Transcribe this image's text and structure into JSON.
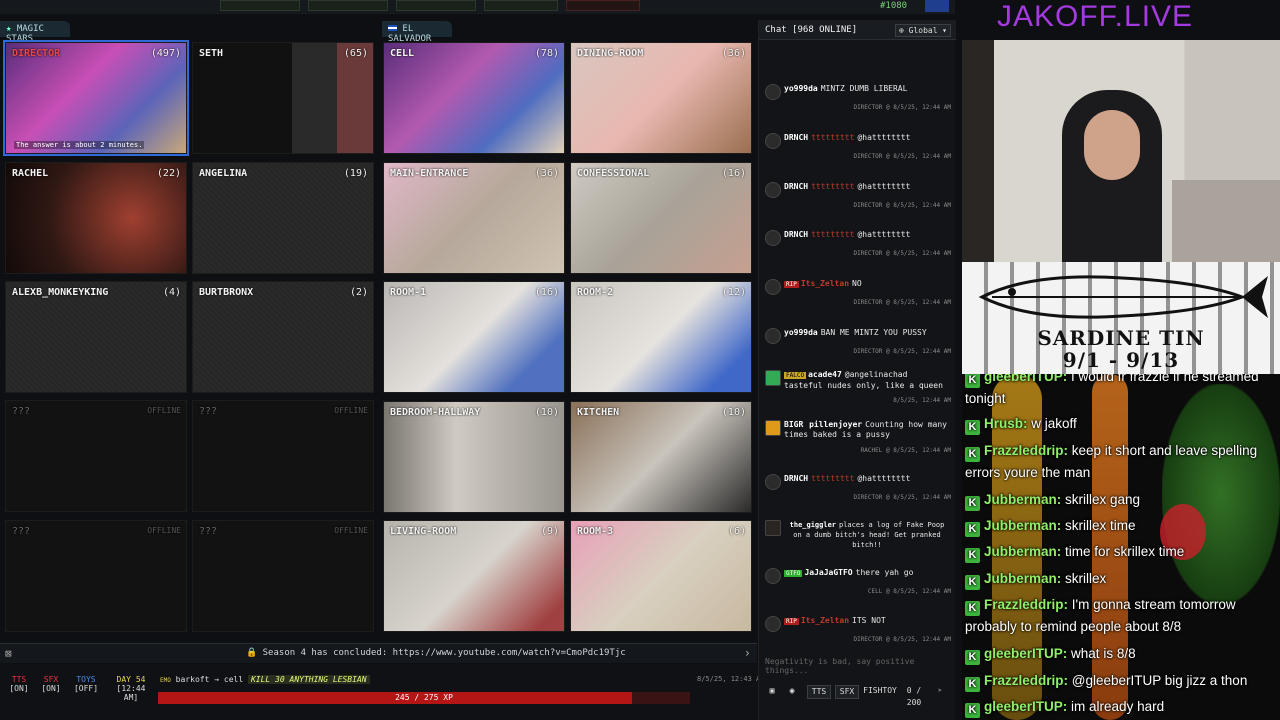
{
  "top": {
    "count": "#1080"
  },
  "sections": {
    "left": "MAGIC STARS",
    "right": "EL SALVADOR"
  },
  "left_cams": [
    {
      "label": "DIRECTOR",
      "count": "(497)",
      "caption": "The answer is about 2 minutes."
    },
    {
      "label": "SETH",
      "count": "(65)"
    },
    {
      "label": "RACHEL",
      "count": "(22)"
    },
    {
      "label": "ANGELINA",
      "count": "(19)"
    },
    {
      "label": "ALEXB_MONKEYKING",
      "count": "(4)"
    },
    {
      "label": "BURTBRONX",
      "count": "(2)"
    },
    {
      "label": "???",
      "count": "OFFLINE"
    },
    {
      "label": "???",
      "count": "OFFLINE"
    },
    {
      "label": "???",
      "count": "OFFLINE"
    },
    {
      "label": "???",
      "count": "OFFLINE"
    }
  ],
  "right_cams": [
    {
      "label": "CELL",
      "count": "(78)"
    },
    {
      "label": "DINING-ROOM",
      "count": "(36)"
    },
    {
      "label": "MAIN-ENTRANCE",
      "count": "(36)"
    },
    {
      "label": "CONFESSIONAL",
      "count": "(16)"
    },
    {
      "label": "ROOM-1",
      "count": "(16)"
    },
    {
      "label": "ROOM-2",
      "count": "(12)"
    },
    {
      "label": "BEDROOM-HALLWAY",
      "count": "(10)"
    },
    {
      "label": "KITCHEN",
      "count": "(10)"
    },
    {
      "label": "LIVING-ROOM",
      "count": "(9)"
    },
    {
      "label": "ROOM-3",
      "count": "(6)"
    }
  ],
  "announce": "Season 4 has concluded: https://www.youtube.com/watch?v=CmoPdc19Tjc",
  "controls": {
    "tts": "TTS",
    "tts_state": "[ON]",
    "sfx": "SFX",
    "sfx_state": "[ON]",
    "toys": "TOYS",
    "toys_state": "[OFF]",
    "day": "DAY 54",
    "time": "[12:44 AM]",
    "cmd_badge": "EMO",
    "cmd_user": "barkoft",
    "cmd_arrow": "→",
    "cmd_target": "cell",
    "cmd_text": "KILL 30 ANYTHING LESBIAN",
    "cmd_time": "8/5/25, 12:43 AM",
    "xp": "245 / 275 XP",
    "xp_fraction": 0.891
  },
  "chat": {
    "title": "Chat [968 ONLINE]",
    "channel": "Global",
    "messages": [
      {
        "user": "yo999da",
        "text": "MINTZ DUMB LIBERAL",
        "meta": "DIRECTOR @ 8/5/25, 12:44 AM",
        "color": "#ffffff"
      },
      {
        "user": "DRNCH",
        "mention": "@hatttttttt",
        "meta": "DIRECTOR @ 8/5/25, 12:44 AM"
      },
      {
        "user": "DRNCH",
        "mention": "@hatttttttt",
        "meta": "DIRECTOR @ 8/5/25, 12:44 AM"
      },
      {
        "user": "DRNCH",
        "mention": "@hatttttttt",
        "meta": "DIRECTOR @ 8/5/25, 12:44 AM"
      },
      {
        "badge": "RIP",
        "user": "Its_Zeltan",
        "text": "NO",
        "meta": "DIRECTOR @ 8/5/25, 12:44 AM"
      },
      {
        "user": "yo999da",
        "text": "BAN ME MINTZ YOU PUSSY",
        "meta": "DIRECTOR @ 8/5/25, 12:44 AM"
      },
      {
        "badge": "FALCO",
        "user": "acade47",
        "text": "@angelinachad tasteful nudes only, like a queen",
        "meta": "8/5/25, 12:44 AM"
      },
      {
        "badge": "BIGR",
        "user": "pillenjoyer",
        "text": "Counting how many times baked is a pussy",
        "meta": "RACHEL @ 8/5/25, 12:44 AM"
      },
      {
        "user": "DRNCH",
        "mention": "@hatttttttt",
        "meta": "DIRECTOR @ 8/5/25, 12:44 AM"
      },
      {
        "user": "the_giggler",
        "text": "places a log of Fake Poop on a dumb bitch's head! Get pranked bitch!!"
      },
      {
        "badge": "GTFO",
        "user": "JaJaJaGTFO",
        "text": "there yah go",
        "meta": "CELL @ 8/5/25, 12:44 AM"
      },
      {
        "badge": "RIP",
        "user": "Its_Zeltan",
        "text": "ITS NOT",
        "meta": "DIRECTOR @ 8/5/25, 12:44 AM"
      }
    ],
    "input_placeholder": "Negativity is bad, say positive things...",
    "btn_tts": "TTS",
    "btn_sfx": "SFX",
    "btn_fishtoy": "FISHTOY",
    "char_count": "0 / 200"
  },
  "overlay": {
    "brand": "JAKOFF.LIVE",
    "sardine_title": "SARDINE TIN",
    "sardine_dates": "9/1 - 9/13",
    "twitch_chat": [
      {
        "user": "gleeberITUP:",
        "text": "I would fr frazzle if he streamed tonight"
      },
      {
        "user": "Hrusb:",
        "text": "w jakoff"
      },
      {
        "user": "Frazzleddrip:",
        "text": "keep it short and leave spelling errors youre the man"
      },
      {
        "user": "Jubberman:",
        "text": "skrillex gang"
      },
      {
        "user": "Jubberman:",
        "text": "skrillex time"
      },
      {
        "user": "Jubberman:",
        "text": "time for skrillex time"
      },
      {
        "user": "Jubberman:",
        "text": "skrillex"
      },
      {
        "user": "Frazzleddrip:",
        "text": "I'm gonna stream tomorrow probably to remind people about 8/8"
      },
      {
        "user": "gleeberITUP:",
        "text": "what is 8/8"
      },
      {
        "user": "Frazzleddrip:",
        "text": "@gleeberITUP big jizz a thon"
      },
      {
        "user": "gleeberITUP:",
        "text": "im already hard"
      }
    ]
  }
}
